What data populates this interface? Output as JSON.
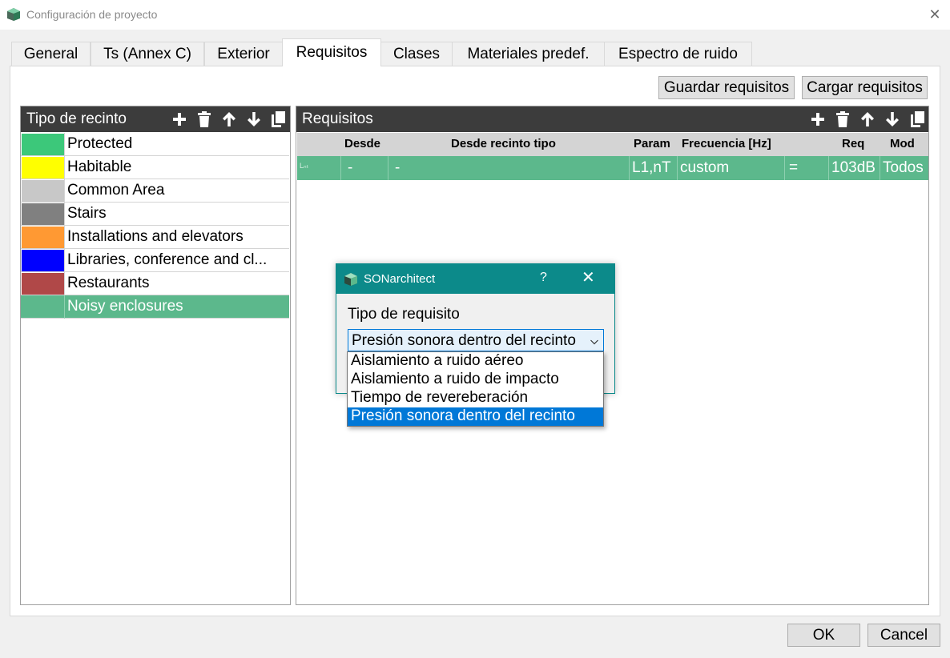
{
  "window": {
    "title": "Configuración de proyecto",
    "close_glyph": "✕"
  },
  "tabs": [
    {
      "label": "General",
      "active": false
    },
    {
      "label": "Ts (Annex C)",
      "active": false
    },
    {
      "label": "Exterior",
      "active": false
    },
    {
      "label": "Requisitos",
      "active": true
    },
    {
      "label": "Clases",
      "active": false
    },
    {
      "label": "Materiales predef.",
      "active": false
    },
    {
      "label": "Espectro de ruido",
      "active": false
    }
  ],
  "toolbar": {
    "save_label": "Guardar requisitos",
    "load_label": "Cargar requisitos"
  },
  "room_types": {
    "title": "Tipo de recinto",
    "icons": [
      "plus-icon",
      "trash-icon",
      "arrow-up-icon",
      "arrow-down-icon",
      "copy-icon"
    ],
    "items": [
      {
        "label": "Protected",
        "color": "#3cc87a"
      },
      {
        "label": "Habitable",
        "color": "#ffff00"
      },
      {
        "label": "Common Area",
        "color": "#c8c8c8"
      },
      {
        "label": "Stairs",
        "color": "#808080"
      },
      {
        "label": "Installations and elevators",
        "color": "#ff9933"
      },
      {
        "label": "Libraries, conference and cl...",
        "color": "#0000ff"
      },
      {
        "label": "Restaurants",
        "color": "#b04848"
      },
      {
        "label": "Noisy enclosures",
        "color": "#5cb88c",
        "selected": true
      }
    ]
  },
  "requirements": {
    "title": "Requisitos",
    "icons": [
      "plus-icon",
      "trash-icon",
      "arrow-up-icon",
      "arrow-down-icon",
      "copy-icon"
    ],
    "columns": [
      "Desde",
      "Desde recinto tipo",
      "Param",
      "Frecuencia [Hz]",
      "Req",
      "Mod"
    ],
    "rows": [
      {
        "icon_text": "Lₙₜ",
        "desde": "-",
        "desde_recinto_tipo": "-",
        "param": "L1,nT",
        "frecuencia": "custom",
        "op": "=",
        "req": "103dB",
        "mod": "Todos"
      }
    ]
  },
  "dialog": {
    "title": "SONarchitect",
    "help_glyph": "?",
    "close_glyph": "✕",
    "label": "Tipo de requisito",
    "selected": "Presión sonora dentro del recinto",
    "options": [
      "Aislamiento a ruido aéreo",
      "Aislamiento a ruido de impacto",
      "Tiempo de revereberación",
      "Presión sonora dentro del recinto"
    ],
    "highlighted_index": 3
  },
  "footer": {
    "ok_label": "OK",
    "cancel_label": "Cancel"
  },
  "colors": {
    "accent_teal": "#0c8a8a",
    "row_green": "#5cb88c",
    "header_dark": "#3c3c3c",
    "selection_blue": "#0078d7"
  }
}
